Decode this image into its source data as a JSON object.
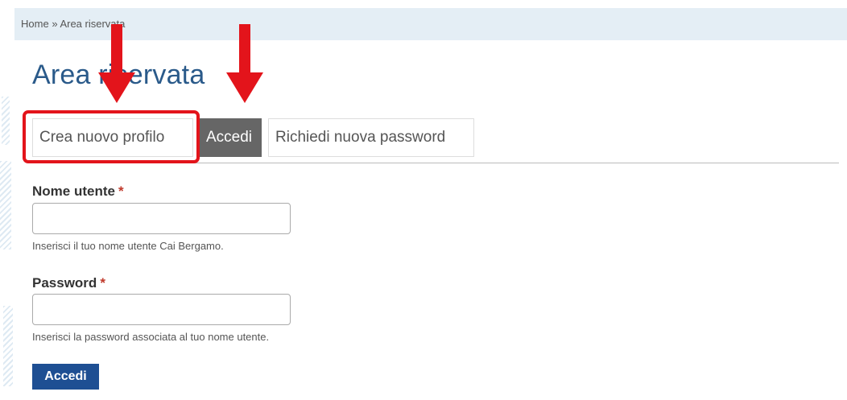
{
  "breadcrumb": {
    "home": "Home",
    "separator": "»",
    "current": "Area riservata"
  },
  "page": {
    "title": "Area riservata"
  },
  "tabs": [
    {
      "label": "Crea nuovo profilo",
      "active": false
    },
    {
      "label": "Accedi",
      "active": true
    },
    {
      "label": "Richiedi nuova password",
      "active": false
    }
  ],
  "form": {
    "username": {
      "label": "Nome utente",
      "required_marker": "*",
      "value": "",
      "help": "Inserisci il tuo nome utente Cai Bergamo."
    },
    "password": {
      "label": "Password",
      "required_marker": "*",
      "value": "",
      "help": "Inserisci la password associata al tuo nome utente."
    },
    "submit_label": "Accedi"
  },
  "annotations": {
    "color": "#e3141b",
    "arrow_count": 2
  },
  "colors": {
    "title": "#2a5a8a",
    "breadcrumb_bg": "#e4eef5",
    "active_tab_bg": "#666666",
    "submit_bg": "#1e4f93",
    "required": "#c0392b"
  }
}
